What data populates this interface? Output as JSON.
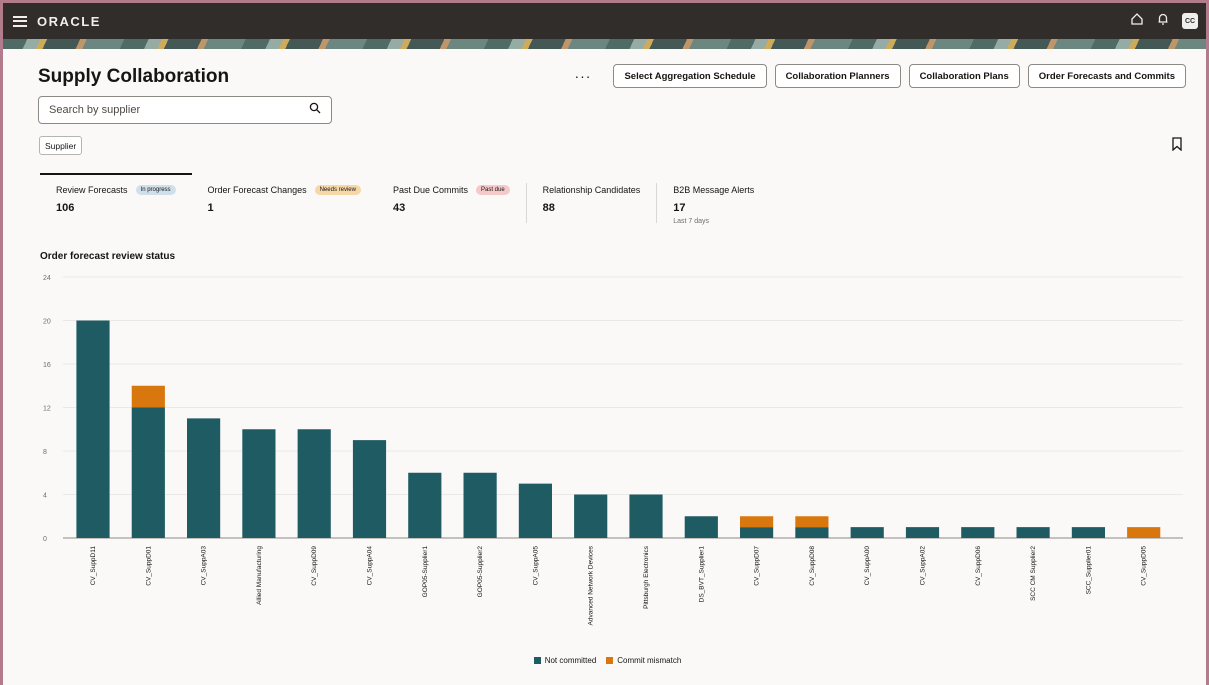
{
  "app": {
    "brand": "ORACLE",
    "avatar_initials": "CC"
  },
  "page": {
    "title": "Supply Collaboration"
  },
  "header": {
    "more_label": "···",
    "buttons": [
      "Select Aggregation Schedule",
      "Collaboration Planners",
      "Collaboration Plans",
      "Order Forecasts and Commits"
    ]
  },
  "search": {
    "placeholder": "Search by supplier",
    "value": ""
  },
  "filter_chip": {
    "label": "Supplier"
  },
  "metrics": [
    {
      "label": "Review Forecasts",
      "badge": "In progress",
      "value": "106",
      "sub": ""
    },
    {
      "label": "Order Forecast Changes",
      "badge": "Needs review",
      "value": "1",
      "sub": ""
    },
    {
      "label": "Past Due Commits",
      "badge": "Past due",
      "value": "43",
      "sub": ""
    },
    {
      "label": "Relationship Candidates",
      "badge": "",
      "value": "88",
      "sub": ""
    },
    {
      "label": "B2B Message Alerts",
      "badge": "",
      "value": "17",
      "sub": "Last 7 days"
    }
  ],
  "colors": {
    "not_committed": "#1f5b63",
    "commit_mismatch": "#d9770f",
    "badge_in_progress": "#cfe0ea",
    "badge_needs_review": "#f6d7a8",
    "badge_past_due": "#f5c9c9"
  },
  "chart_data": {
    "type": "bar",
    "title": "Order forecast review status",
    "stacked": true,
    "ylim": [
      0,
      24
    ],
    "yticks": [
      0,
      4,
      8,
      12,
      16,
      20,
      24
    ],
    "categories": [
      "CV_SuppD11",
      "CV_SuppD01",
      "CV_SuppA03",
      "Allied Manufacturing",
      "CV_SuppD09",
      "CV_SuppA04",
      "GOP05-Supplier1",
      "GOP05-Supplier2",
      "CV_SuppA05",
      "Advanced Network Devices",
      "Pittsburgh Electronics",
      "DS_BVT_Supplier1",
      "CV_SuppD07",
      "CV_SuppD08",
      "CV_SuppA00",
      "CV_SuppA02",
      "CV_SuppD06",
      "SCC CM Supplier2",
      "SCC_Supplier01",
      "CV_SuppD05"
    ],
    "series": [
      {
        "name": "Not committed",
        "values": [
          20,
          12,
          11,
          10,
          10,
          9,
          6,
          6,
          5,
          4,
          4,
          2,
          1,
          1,
          1,
          1,
          1,
          1,
          1,
          0
        ]
      },
      {
        "name": "Commit mismatch",
        "values": [
          0,
          2,
          0,
          0,
          0,
          0,
          0,
          0,
          0,
          0,
          0,
          0,
          1,
          1,
          0,
          0,
          0,
          0,
          0,
          1
        ]
      }
    ],
    "grid": true,
    "legend": "bottom-center"
  }
}
